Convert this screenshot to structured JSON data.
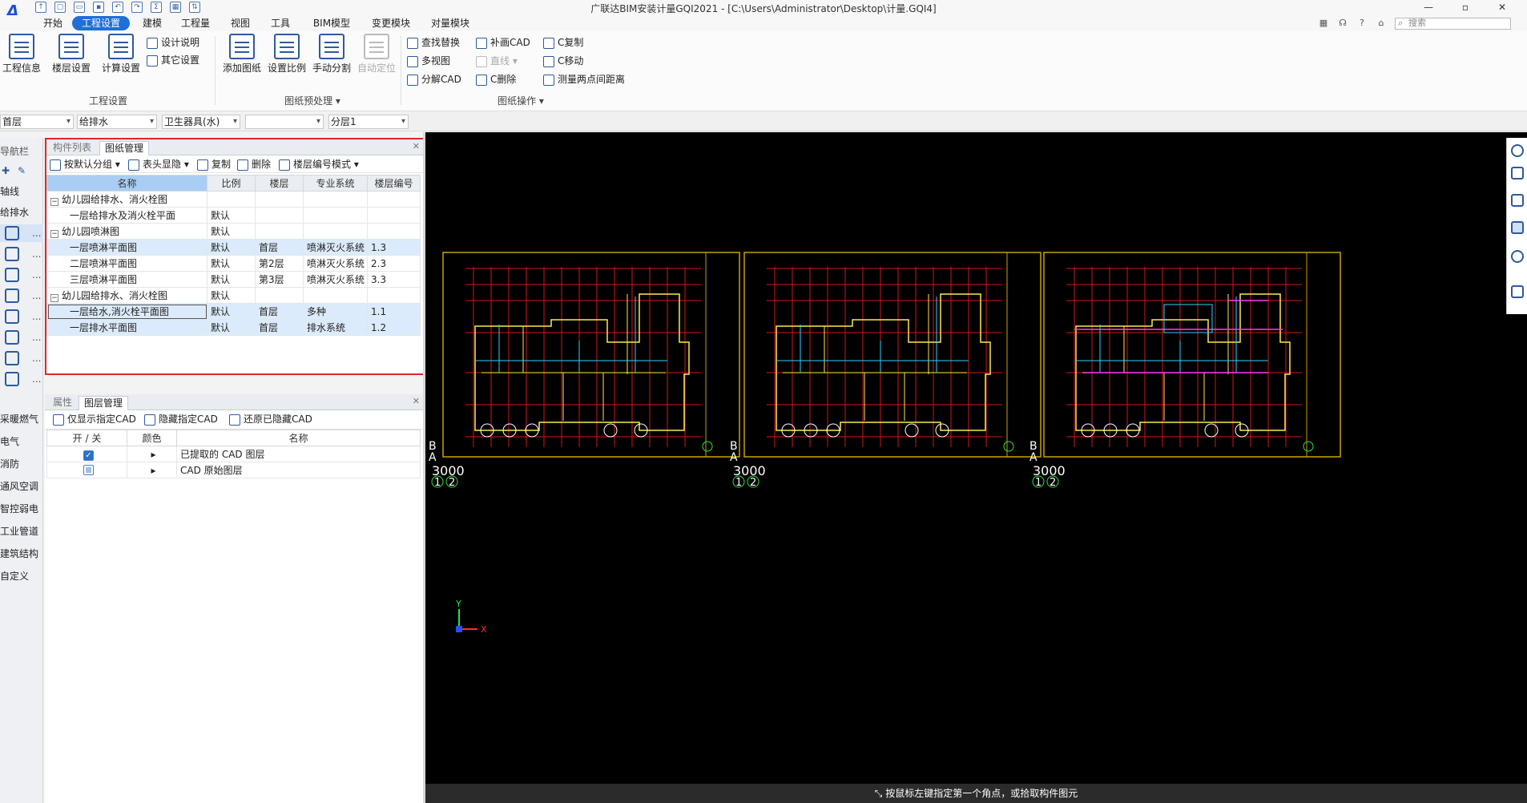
{
  "window": {
    "title": "广联达BIM安装计量GQI2021 - [C:\\Users\\Administrator\\Desktop\\计量.GQI4]",
    "controls": [
      "—",
      "▫",
      "✕"
    ]
  },
  "menu": {
    "items": [
      "开始",
      "工程设置",
      "建模",
      "工程量",
      "视图",
      "工具",
      "BIM模型",
      "变更模块",
      "对量模块"
    ],
    "active": "工程设置",
    "search_placeholder": "搜索"
  },
  "ribbon": {
    "group1": {
      "label": "工程设置",
      "buttons": [
        "工程信息",
        "楼层设置",
        "计算设置"
      ],
      "small": [
        "设计说明",
        "其它设置"
      ]
    },
    "group2": {
      "label": "图纸预处理 ▾",
      "buttons": [
        "添加图纸",
        "设置比例",
        "手动分割",
        "自动定位"
      ]
    },
    "group3": {
      "label": "图纸操作 ▾",
      "small_col1": [
        "查找替换",
        "多视图",
        "分解CAD"
      ],
      "small_col2": [
        "补画CAD",
        "直线 ▾",
        "C删除"
      ],
      "small_col3": [
        "C复制",
        "C移动",
        "测量两点间距离"
      ]
    }
  },
  "filters": [
    "首层",
    "给排水",
    "卫生器具(水)",
    "",
    "分层1"
  ],
  "nav": {
    "header": "导航栏",
    "items": [
      {
        "label": "轴线",
        "icon": "axis-icon"
      },
      {
        "label": "给排水",
        "icon": "water-icon"
      },
      {
        "label": "",
        "icon": "sanitary-icon",
        "dots": "..."
      },
      {
        "label": "",
        "icon": "pipe-icon",
        "dots": "..."
      },
      {
        "label": "",
        "icon": "valve-icon",
        "dots": "..."
      },
      {
        "label": "",
        "icon": "fitting-icon",
        "dots": "..."
      },
      {
        "label": "",
        "icon": "equipment-icon",
        "dots": "..."
      },
      {
        "label": "",
        "icon": "pump-icon",
        "dots": "..."
      },
      {
        "label": "",
        "icon": "sleeve-icon",
        "dots": "..."
      },
      {
        "label": "",
        "icon": "support-icon",
        "dots": "..."
      },
      {
        "label": "采暖燃气"
      },
      {
        "label": "电气"
      },
      {
        "label": "消防"
      },
      {
        "label": "通风空调"
      },
      {
        "label": "智控弱电"
      },
      {
        "label": "工业管道"
      },
      {
        "label": "建筑结构"
      },
      {
        "label": "自定义"
      }
    ]
  },
  "drawing_panel": {
    "tabs": [
      "构件列表",
      "图纸管理"
    ],
    "active_tab": "图纸管理",
    "toolbar": [
      "按默认分组 ▾",
      "表头显隐 ▾",
      "复制",
      "删除",
      "楼层编号模式 ▾"
    ],
    "columns": [
      "名称",
      "比例",
      "楼层",
      "专业系统",
      "楼层编号"
    ],
    "rows": [
      {
        "name": "幼儿园给排水、消火栓图",
        "scale": "",
        "floor": "",
        "system": "",
        "code": "",
        "group": true
      },
      {
        "name": "一层给排水及消火栓平面",
        "scale": "默认",
        "floor": "",
        "system": "",
        "code": ""
      },
      {
        "name": "幼儿园喷淋图",
        "scale": "默认",
        "floor": "",
        "system": "",
        "code": "",
        "group": true
      },
      {
        "name": "一层喷淋平面图",
        "scale": "默认",
        "floor": "首层",
        "system": "喷淋灭火系统",
        "code": "1.3",
        "hl": true
      },
      {
        "name": "二层喷淋平面图",
        "scale": "默认",
        "floor": "第2层",
        "system": "喷淋灭火系统",
        "code": "2.3"
      },
      {
        "name": "三层喷淋平面图",
        "scale": "默认",
        "floor": "第3层",
        "system": "喷淋灭火系统",
        "code": "3.3"
      },
      {
        "name": "幼儿园给排水、消火栓图",
        "scale": "默认",
        "floor": "",
        "system": "",
        "code": "",
        "group": true
      },
      {
        "name": "一层给水,消火栓平面图",
        "scale": "默认",
        "floor": "首层",
        "system": "多种",
        "code": "1.1",
        "hl": true,
        "focus": true
      },
      {
        "name": "一层排水平面图",
        "scale": "默认",
        "floor": "首层",
        "system": "排水系统",
        "code": "1.2",
        "hl": true
      }
    ]
  },
  "layer_panel": {
    "tabs": [
      "属性",
      "图层管理"
    ],
    "active_tab": "图层管理",
    "toolbar": [
      "仅显示指定CAD",
      "隐藏指定CAD",
      "还原已隐藏CAD"
    ],
    "columns": [
      "开 / 关",
      "颜色",
      "名称"
    ],
    "rows": [
      {
        "state": "on",
        "color": "▸",
        "name": "已提取的 CAD 图层"
      },
      {
        "state": "partial",
        "color": "▸",
        "name": "CAD 原始图层"
      }
    ]
  },
  "cad": {
    "sheet_labels": [
      [
        "B",
        "A",
        "3000"
      ],
      [
        "B",
        "A",
        "3000"
      ],
      [
        "B",
        "A",
        "3000"
      ]
    ],
    "dims": [
      "3000",
      "3000",
      "3000"
    ],
    "axis_nums": [
      "1",
      "2"
    ],
    "ucs": {
      "x": "X",
      "y": "Y"
    }
  },
  "status": {
    "prompt": "按鼠标左键指定第一个角点，或拾取构件图元"
  },
  "colors": {
    "accent": "#1f6fd6",
    "highlight_box": "#e0262a",
    "cad_bg": "#000000"
  }
}
